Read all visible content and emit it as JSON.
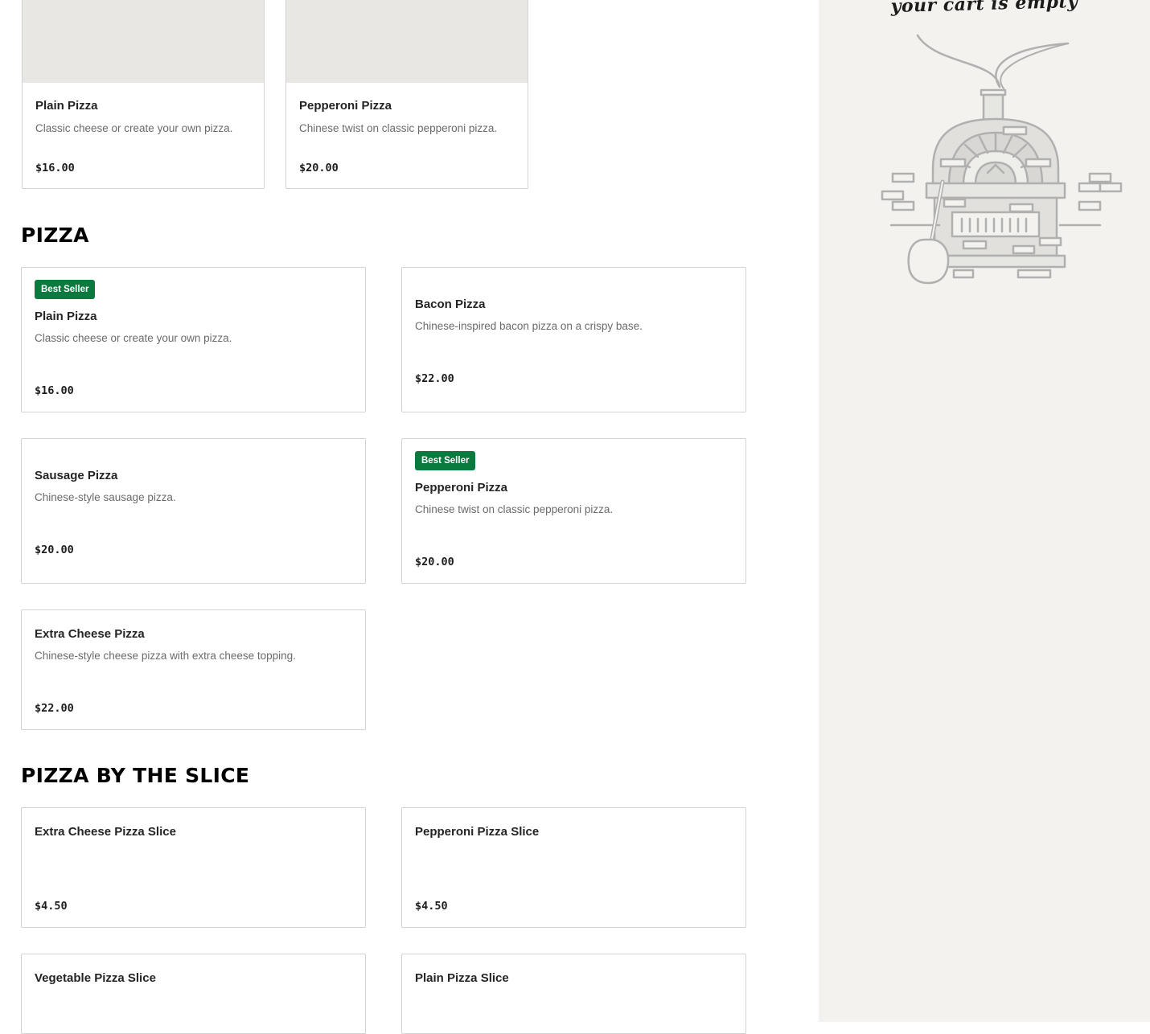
{
  "featured": [
    {
      "name": "Plain Pizza",
      "description": "Classic cheese or create your own pizza.",
      "price": "$16.00"
    },
    {
      "name": "Pepperoni Pizza",
      "description": "Chinese twist on classic pepperoni pizza.",
      "price": "$20.00"
    }
  ],
  "sections": {
    "pizza": {
      "title": "PIZZA",
      "items": [
        {
          "name": "Plain Pizza",
          "description": "Classic cheese or create your own pizza.",
          "price": "$16.00",
          "badge": "Best Seller"
        },
        {
          "name": "Bacon Pizza",
          "description": "Chinese-inspired bacon pizza on a crispy base.",
          "price": "$22.00"
        },
        {
          "name": "Sausage Pizza",
          "description": "Chinese-style sausage pizza.",
          "price": "$20.00"
        },
        {
          "name": "Pepperoni Pizza",
          "description": "Chinese twist on classic pepperoni pizza.",
          "price": "$20.00",
          "badge": "Best Seller"
        },
        {
          "name": "Extra Cheese Pizza",
          "description": "Chinese-style cheese pizza with extra cheese topping.",
          "price": "$22.00"
        }
      ]
    },
    "slice": {
      "title": "PIZZA BY THE SLICE",
      "items": [
        {
          "name": "Extra Cheese Pizza Slice",
          "price": "$4.50"
        },
        {
          "name": "Pepperoni Pizza Slice",
          "price": "$4.50"
        },
        {
          "name": "Vegetable Pizza Slice"
        },
        {
          "name": "Plain Pizza Slice"
        }
      ]
    }
  },
  "cart": {
    "empty_text": "your cart is empty"
  },
  "colors": {
    "badge": "#0b7a3e",
    "cart_panel": "#f3f2ee",
    "image_placeholder": "#e8e7e3"
  }
}
